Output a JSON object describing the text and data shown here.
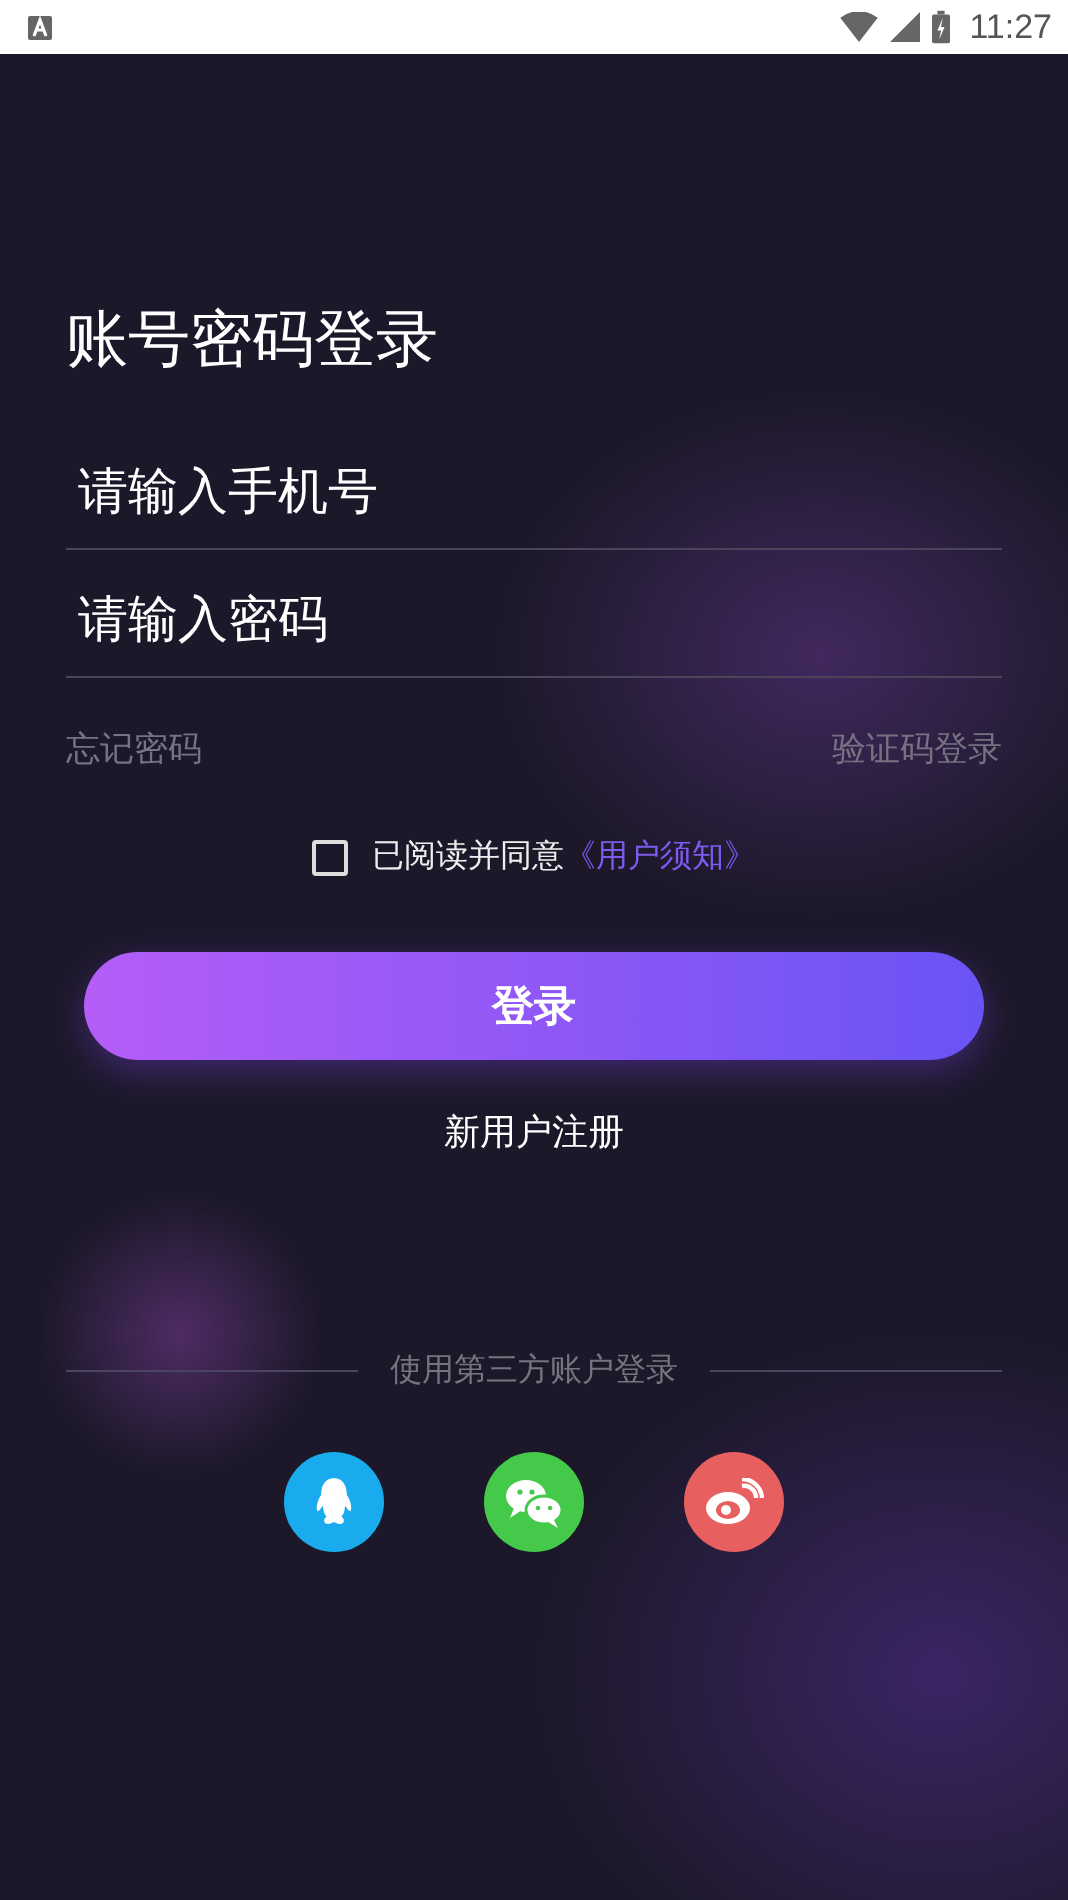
{
  "status_bar": {
    "time": "11:27"
  },
  "title": "账号密码登录",
  "phone_field": {
    "placeholder": "请输入手机号"
  },
  "password_field": {
    "placeholder": "请输入密码"
  },
  "links": [
    "忘记密码",
    "验证码登录"
  ],
  "agreement": {
    "checked": false,
    "text": "已阅读并同意",
    "link": "《用户须知》"
  },
  "login_button": "登录",
  "register_link": "新用户注册",
  "third_party": {
    "label": "使用第三方账户登录",
    "providers": [
      {
        "kind": "penguin",
        "color": "#1aabee"
      },
      {
        "kind": "chat",
        "color": "#45c94a"
      },
      {
        "kind": "swirl",
        "color": "#e85f5f"
      }
    ]
  }
}
